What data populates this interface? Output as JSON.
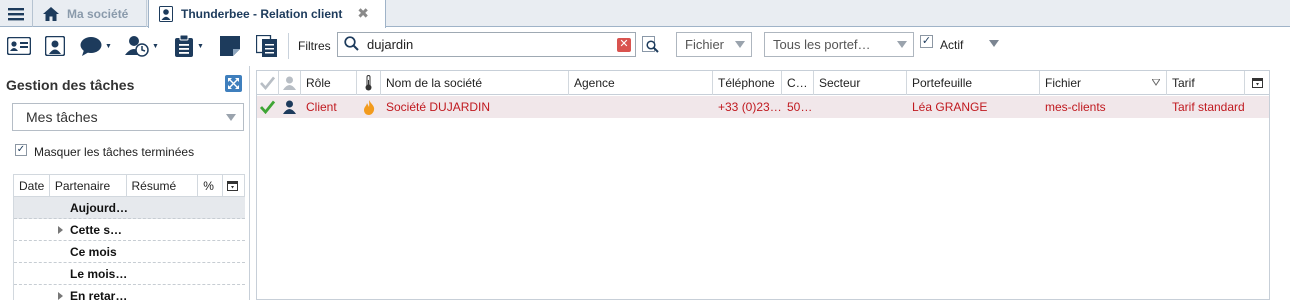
{
  "tabs": [
    {
      "label": "Ma société"
    },
    {
      "label": "Thunderbee - Relation client",
      "close": "✖"
    }
  ],
  "toolbar": {
    "filters_label": "Filtres",
    "search": {
      "value": "dujardin",
      "placeholder": ""
    },
    "fichier": "Fichier",
    "portefeuille": "Tous les portef…",
    "actif_label": "Actif",
    "actif_checked": true
  },
  "task_panel": {
    "title": "Gestion des tâches",
    "view_select": "Mes tâches",
    "hide_done_label": "Masquer les tâches terminées",
    "hide_done_checked": true,
    "columns": [
      "Date",
      "Partenaire",
      "Résumé",
      "%"
    ],
    "groups": [
      {
        "label": "Aujourd…",
        "expandable": false,
        "selected": true
      },
      {
        "label": "Cette s…",
        "expandable": true,
        "selected": false
      },
      {
        "label": "Ce mois",
        "expandable": false,
        "selected": false
      },
      {
        "label": "Le mois…",
        "expandable": false,
        "selected": false
      },
      {
        "label": "En retar…",
        "expandable": true,
        "selected": false
      }
    ]
  },
  "grid": {
    "columns": [
      "Rôle",
      "Nom de la société",
      "Agence",
      "Téléphone",
      "C…",
      "Secteur",
      "Portefeuille",
      "Fichier",
      "Tarif"
    ],
    "rows": [
      {
        "role": "Client",
        "societe": "Société DUJARDIN",
        "agence": "",
        "telephone": "+33 (0)23…",
        "c": "50…",
        "secteur": "",
        "portefeuille": "Léa GRANGE",
        "fichier": "mes-clients",
        "tarif": "Tarif standard"
      }
    ]
  },
  "colors": {
    "accent": "#1d3b5c",
    "row_text": "#c0191f",
    "row_bg": "#f1e7ea",
    "check": "#3fa535",
    "flame": "#f29b1d"
  }
}
